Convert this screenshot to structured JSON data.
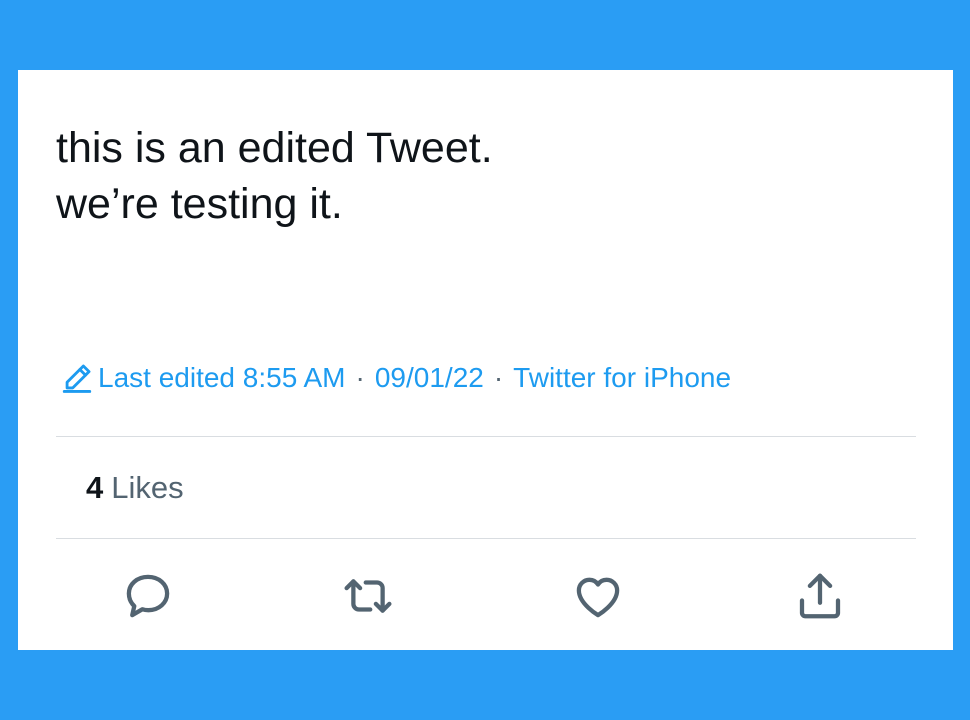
{
  "tweet": {
    "text": "this is an edited Tweet.\nwe’re testing it."
  },
  "meta": {
    "edited_label": "Last edited 8:55 AM",
    "separator": "·",
    "date": "09/01/22",
    "source": "Twitter for iPhone",
    "edit_icon": "pencil-icon"
  },
  "stats": {
    "likes_count": "4",
    "likes_label": "Likes"
  },
  "actions": [
    {
      "name": "reply",
      "icon": "reply-icon"
    },
    {
      "name": "retweet",
      "icon": "retweet-icon"
    },
    {
      "name": "like",
      "icon": "heart-icon"
    },
    {
      "name": "share",
      "icon": "share-icon"
    }
  ],
  "colors": {
    "background": "#2a9df4",
    "accent": "#1d9bf0",
    "text": "#0f1419",
    "muted": "#536471",
    "divider": "#d9dde1"
  }
}
